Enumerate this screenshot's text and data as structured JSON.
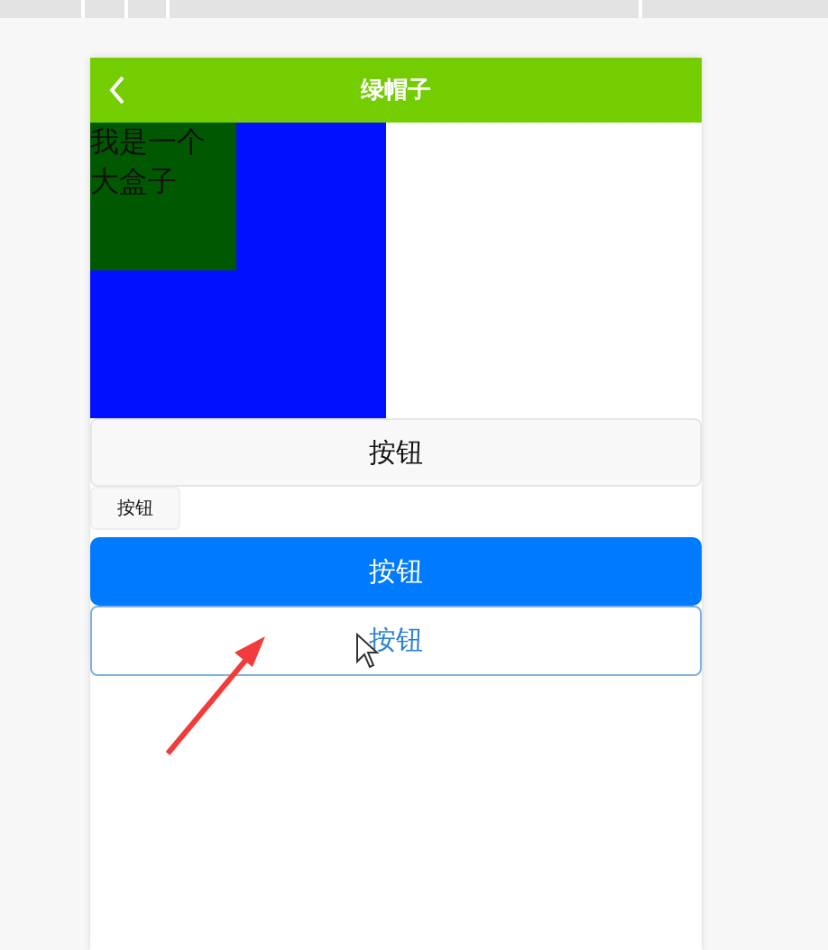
{
  "nav_bar": {
    "title": "绿帽子"
  },
  "box": {
    "text": "我是一个大盒子"
  },
  "buttons": [
    {
      "label": "按钮",
      "kind": "default"
    },
    {
      "label": "按钮",
      "kind": "mini"
    },
    {
      "label": "按钮",
      "kind": "primary"
    },
    {
      "label": "按钮",
      "kind": "plain"
    }
  ]
}
